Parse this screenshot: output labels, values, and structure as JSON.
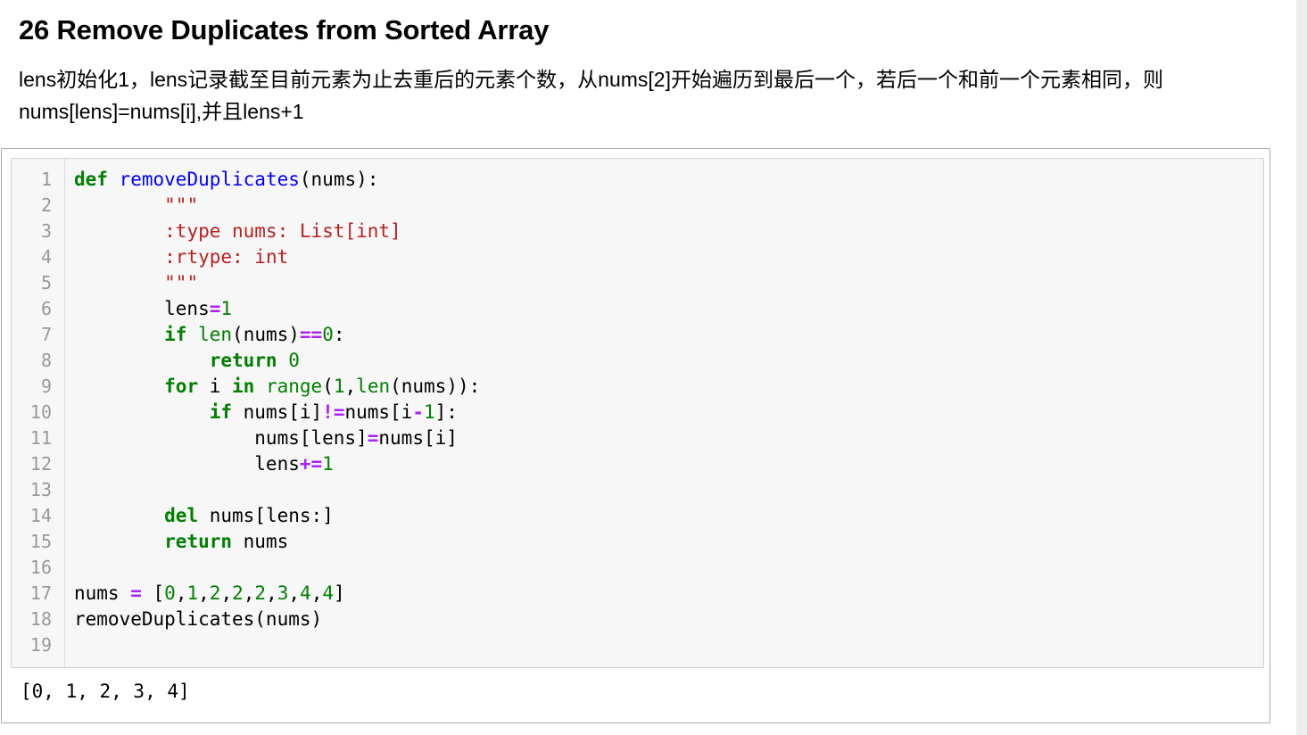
{
  "markdown": {
    "title": "26 Remove Duplicates from Sorted Array",
    "description": "lens初始化1，lens记录截至目前元素为止去重后的元素个数，从nums[2]开始遍历到最后一个，若后一个和前一个元素相同，则nums[lens]=nums[i],并且lens+1"
  },
  "code_cell": {
    "line_numbers": [
      "1",
      "2",
      "3",
      "4",
      "5",
      "6",
      "7",
      "8",
      "9",
      "10",
      "11",
      "12",
      "13",
      "14",
      "15",
      "16",
      "17",
      "18",
      "19"
    ],
    "lines": [
      [
        {
          "t": "kw",
          "v": "def"
        },
        {
          "t": "",
          "v": " "
        },
        {
          "t": "fn",
          "v": "removeDuplicates"
        },
        {
          "t": "",
          "v": "(nums):"
        }
      ],
      [
        {
          "t": "",
          "v": "        "
        },
        {
          "t": "st",
          "v": "\"\"\""
        }
      ],
      [
        {
          "t": "",
          "v": "        "
        },
        {
          "t": "st",
          "v": ":type nums: List[int]"
        }
      ],
      [
        {
          "t": "",
          "v": "        "
        },
        {
          "t": "st",
          "v": ":rtype: int"
        }
      ],
      [
        {
          "t": "",
          "v": "        "
        },
        {
          "t": "st",
          "v": "\"\"\""
        }
      ],
      [
        {
          "t": "",
          "v": "        lens"
        },
        {
          "t": "op",
          "v": "="
        },
        {
          "t": "nm",
          "v": "1"
        }
      ],
      [
        {
          "t": "",
          "v": "        "
        },
        {
          "t": "kw",
          "v": "if"
        },
        {
          "t": "",
          "v": " "
        },
        {
          "t": "bi",
          "v": "len"
        },
        {
          "t": "",
          "v": "(nums)"
        },
        {
          "t": "op",
          "v": "=="
        },
        {
          "t": "nm",
          "v": "0"
        },
        {
          "t": "",
          "v": ":"
        }
      ],
      [
        {
          "t": "",
          "v": "            "
        },
        {
          "t": "kw",
          "v": "return"
        },
        {
          "t": "",
          "v": " "
        },
        {
          "t": "nm",
          "v": "0"
        }
      ],
      [
        {
          "t": "",
          "v": "        "
        },
        {
          "t": "kw",
          "v": "for"
        },
        {
          "t": "",
          "v": " i "
        },
        {
          "t": "kw",
          "v": "in"
        },
        {
          "t": "",
          "v": " "
        },
        {
          "t": "bi",
          "v": "range"
        },
        {
          "t": "",
          "v": "("
        },
        {
          "t": "nm",
          "v": "1"
        },
        {
          "t": "",
          "v": ","
        },
        {
          "t": "bi",
          "v": "len"
        },
        {
          "t": "",
          "v": "(nums)):"
        }
      ],
      [
        {
          "t": "",
          "v": "            "
        },
        {
          "t": "kw",
          "v": "if"
        },
        {
          "t": "",
          "v": " nums[i]"
        },
        {
          "t": "op",
          "v": "!="
        },
        {
          "t": "",
          "v": "nums[i"
        },
        {
          "t": "op",
          "v": "-"
        },
        {
          "t": "nm",
          "v": "1"
        },
        {
          "t": "",
          "v": "]:"
        }
      ],
      [
        {
          "t": "",
          "v": "                nums[lens]"
        },
        {
          "t": "op",
          "v": "="
        },
        {
          "t": "",
          "v": "nums[i]"
        }
      ],
      [
        {
          "t": "",
          "v": "                lens"
        },
        {
          "t": "op",
          "v": "+="
        },
        {
          "t": "nm",
          "v": "1"
        }
      ],
      [
        {
          "t": "",
          "v": ""
        }
      ],
      [
        {
          "t": "",
          "v": "        "
        },
        {
          "t": "kw",
          "v": "del"
        },
        {
          "t": "",
          "v": " nums[lens:]"
        }
      ],
      [
        {
          "t": "",
          "v": "        "
        },
        {
          "t": "kw",
          "v": "return"
        },
        {
          "t": "",
          "v": " nums"
        }
      ],
      [
        {
          "t": "",
          "v": ""
        }
      ],
      [
        {
          "t": "",
          "v": "nums "
        },
        {
          "t": "op",
          "v": "="
        },
        {
          "t": "",
          "v": " ["
        },
        {
          "t": "nm",
          "v": "0"
        },
        {
          "t": "",
          "v": ","
        },
        {
          "t": "nm",
          "v": "1"
        },
        {
          "t": "",
          "v": ","
        },
        {
          "t": "nm",
          "v": "2"
        },
        {
          "t": "",
          "v": ","
        },
        {
          "t": "nm",
          "v": "2"
        },
        {
          "t": "",
          "v": ","
        },
        {
          "t": "nm",
          "v": "2"
        },
        {
          "t": "",
          "v": ","
        },
        {
          "t": "nm",
          "v": "3"
        },
        {
          "t": "",
          "v": ","
        },
        {
          "t": "nm",
          "v": "4"
        },
        {
          "t": "",
          "v": ","
        },
        {
          "t": "nm",
          "v": "4"
        },
        {
          "t": "",
          "v": "]"
        }
      ],
      [
        {
          "t": "",
          "v": "removeDuplicates(nums)"
        }
      ],
      [
        {
          "t": "",
          "v": ""
        }
      ]
    ],
    "output": "[0, 1, 2, 3, 4]"
  }
}
